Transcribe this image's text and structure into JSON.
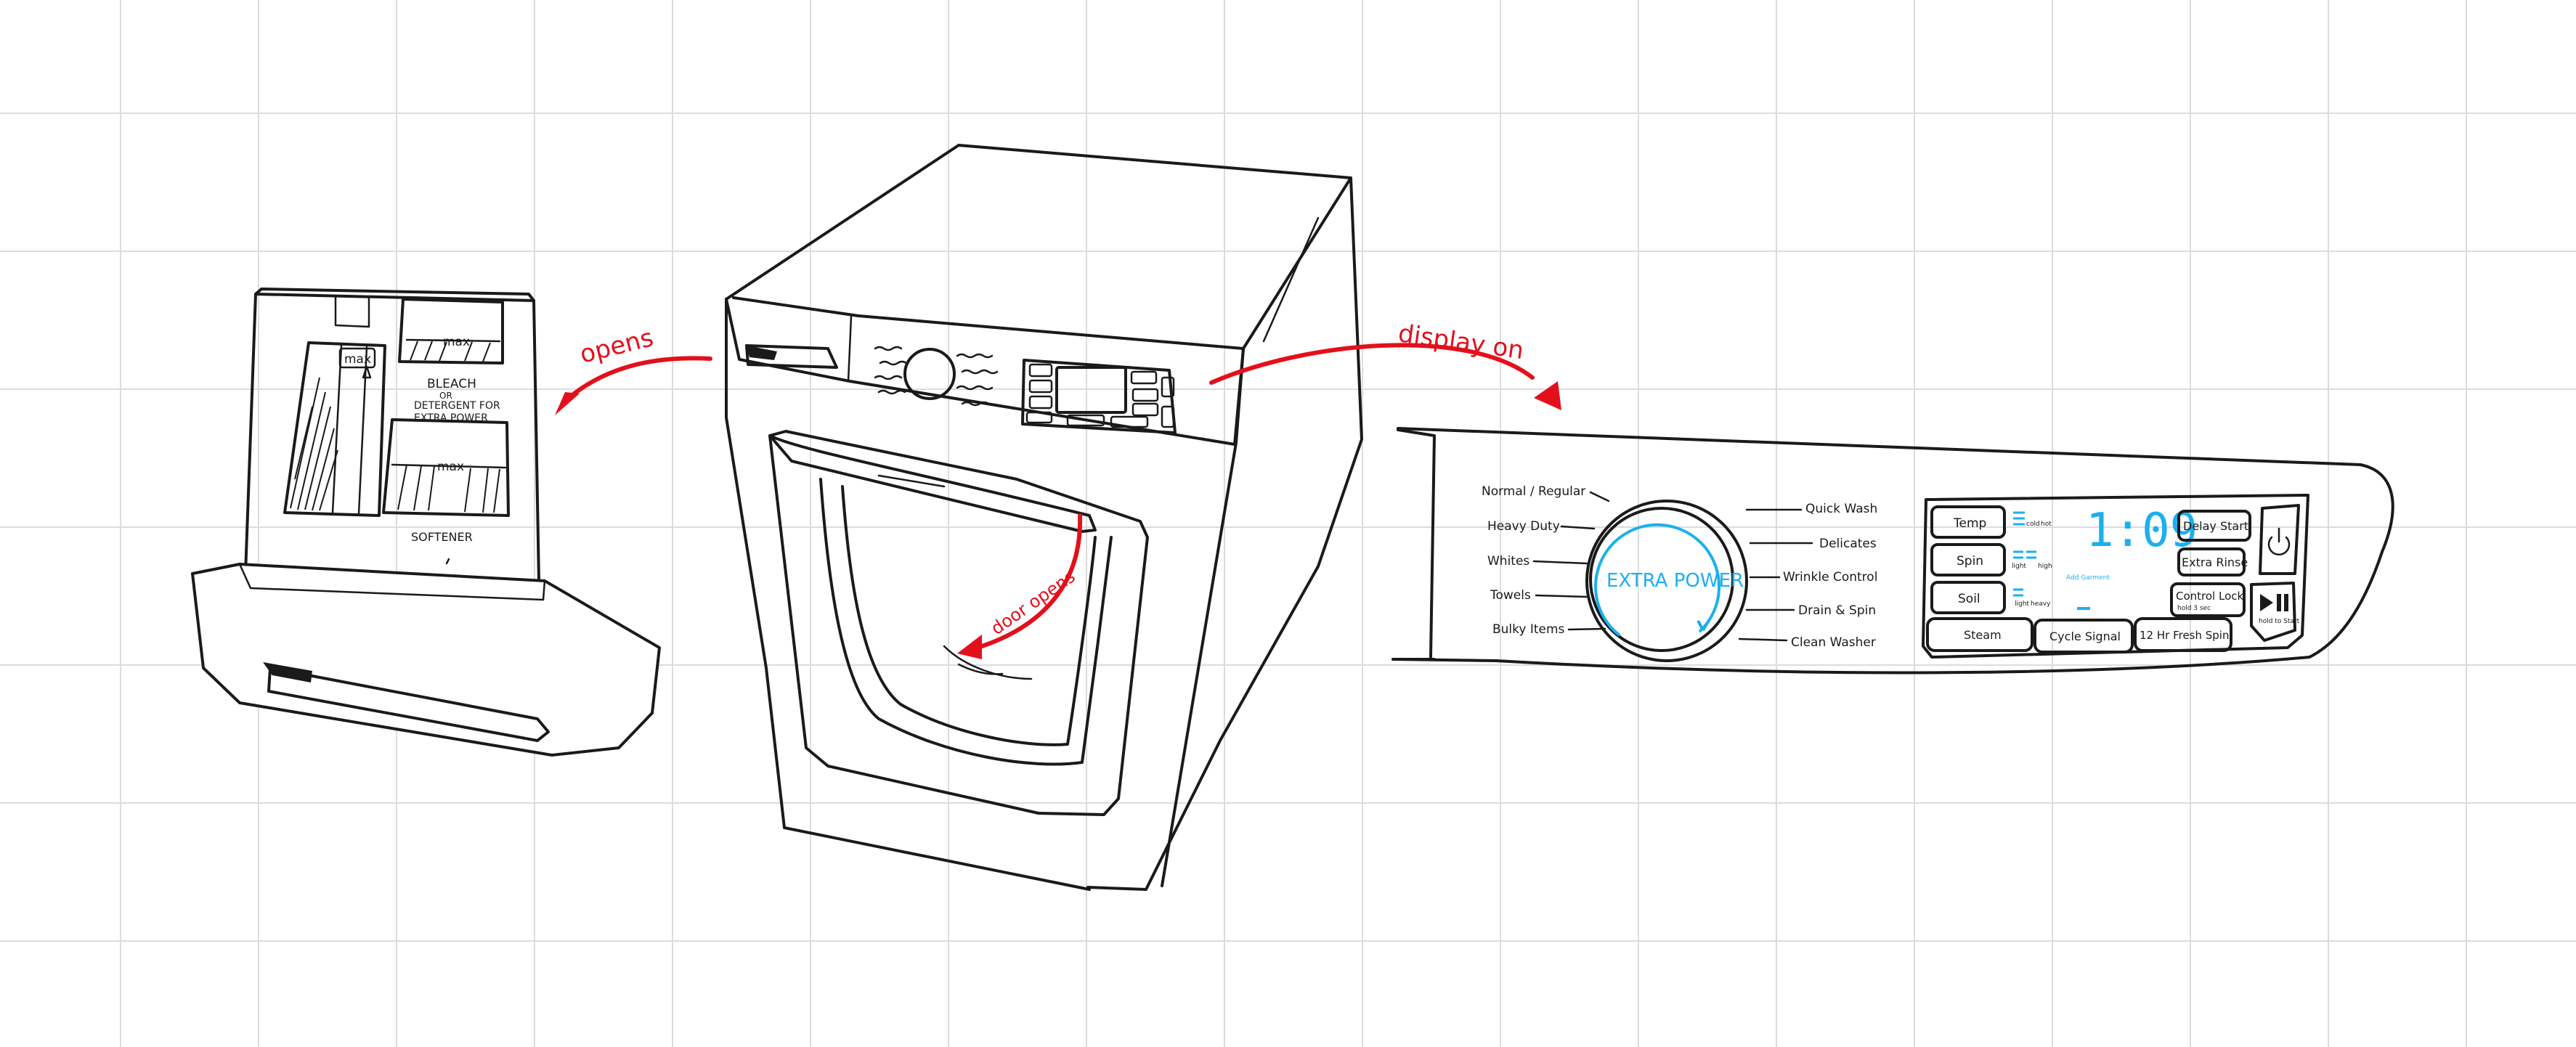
{
  "arrows": {
    "opens": "opens",
    "display_on": "display on",
    "door_opens": "door opens"
  },
  "drawer": {
    "max_small": "max",
    "max_top": "max",
    "bleach_title": "BLEACH",
    "bleach_or": "OR",
    "bleach_line2": "DETERGENT FOR",
    "bleach_line3": "EXTRA POWER",
    "max_bottom": "max",
    "softener": "SOFTENER"
  },
  "control_panel": {
    "dial_text": "EXTRA POWER",
    "cycles_left": [
      "Normal / Regular",
      "Heavy Duty",
      "Whites",
      "Towels",
      "Bulky Items"
    ],
    "cycles_right": [
      "Quick Wash",
      "Delicates",
      "Wrinkle Control",
      "Drain & Spin",
      "Clean Washer"
    ],
    "buttons": {
      "temp": "Temp",
      "spin": "Spin",
      "soil": "Soil",
      "steam": "Steam",
      "cycle_signal": "Cycle Signal",
      "fresh_spin": "12 Hr Fresh Spin",
      "delay_start": "Delay Start",
      "extra_rinse": "Extra Rinse",
      "control_lock": "Control Lock",
      "control_lock_sub": "hold 3 sec",
      "hold_to_start": "hold to Start"
    },
    "display": {
      "time": "1:09",
      "temp_cold": "cold",
      "temp_hot": "hot",
      "spin_light": "light",
      "spin_high": "high",
      "soil_light": "light",
      "soil_heavy": "heavy",
      "add_garment": "Add Garment"
    }
  },
  "colors": {
    "ink": "#1a1a1a",
    "arrow_red": "#e3101c",
    "display_blue": "#1ab0ee",
    "grid": "#dcdcdc"
  }
}
